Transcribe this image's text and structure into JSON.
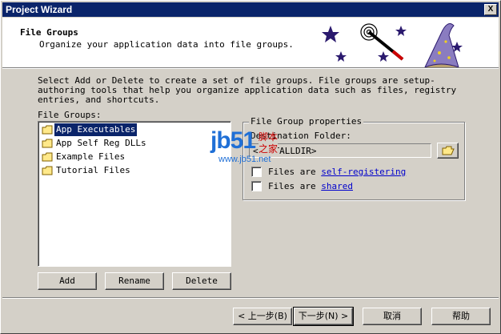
{
  "window": {
    "title": "Project Wizard",
    "close_label": "X"
  },
  "header": {
    "title": "File Groups",
    "subtitle": "Organize your application data into file groups."
  },
  "description": "Select Add or Delete to create a set of file groups.  File groups are setup-authoring tools that help you organize application data such as files, registry entries, and shortcuts.",
  "file_groups": {
    "label": "File Groups:",
    "items": [
      {
        "label": "App Executables",
        "selected": true
      },
      {
        "label": "App Self Reg DLLs",
        "selected": false
      },
      {
        "label": "Example Files",
        "selected": false
      },
      {
        "label": "Tutorial Files",
        "selected": false
      }
    ],
    "buttons": {
      "add": "Add",
      "rename": "Rename",
      "delete": "Delete"
    }
  },
  "properties": {
    "title": "File Group properties",
    "dest_label": "Destination Folder:",
    "dest_value": "<INSTALLDIR>",
    "self_registering_prefix": "Files are",
    "self_registering_link": "self-registering",
    "shared_prefix": "Files are",
    "shared_link": "shared",
    "self_registering_checked": false,
    "shared_checked": false
  },
  "watermark": {
    "logo": "jb51",
    "line1": "脚本",
    "line2": "之家",
    "url": "www.jb51.net"
  },
  "footer": {
    "back": "< 上一步(B)",
    "next": "下一步(N) >",
    "cancel": "取消",
    "help": "帮助"
  },
  "colors": {
    "titlebar": "#0a246a",
    "face": "#d4d0c8",
    "link": "#0000cc",
    "selection": "#0a246a"
  }
}
